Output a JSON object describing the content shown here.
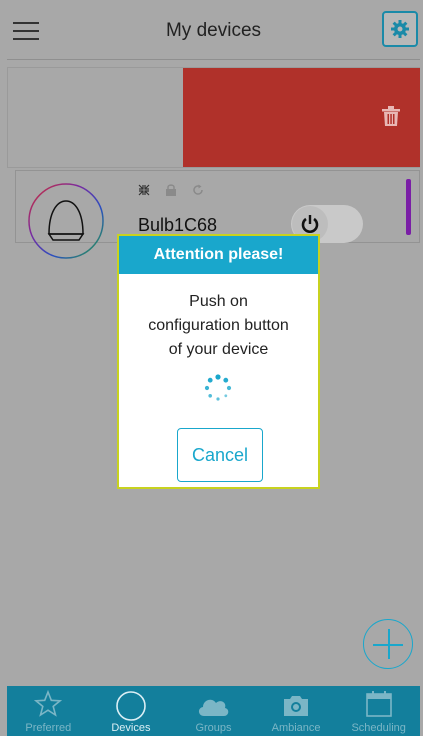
{
  "header": {
    "title": "My devices"
  },
  "device": {
    "name": "Bulb1C68",
    "color_indicator": "#7a1ea6"
  },
  "dialog": {
    "title": "Attention please!",
    "message_line1": "Push on",
    "message_line2": "configuration button",
    "message_line3": "of your device",
    "cancel_label": "Cancel"
  },
  "tabs": [
    {
      "label": "Preferred",
      "icon": "star-icon"
    },
    {
      "label": "Devices",
      "icon": "circle-icon"
    },
    {
      "label": "Groups",
      "icon": "cloud-icon"
    },
    {
      "label": "Ambiance",
      "icon": "camera-icon"
    },
    {
      "label": "Scheduling",
      "icon": "calendar-icon"
    }
  ],
  "colors": {
    "accent": "#19a7cc",
    "delete": "#b0312a",
    "tabbar": "#137f9c",
    "dialog_border": "#c8d21f"
  }
}
